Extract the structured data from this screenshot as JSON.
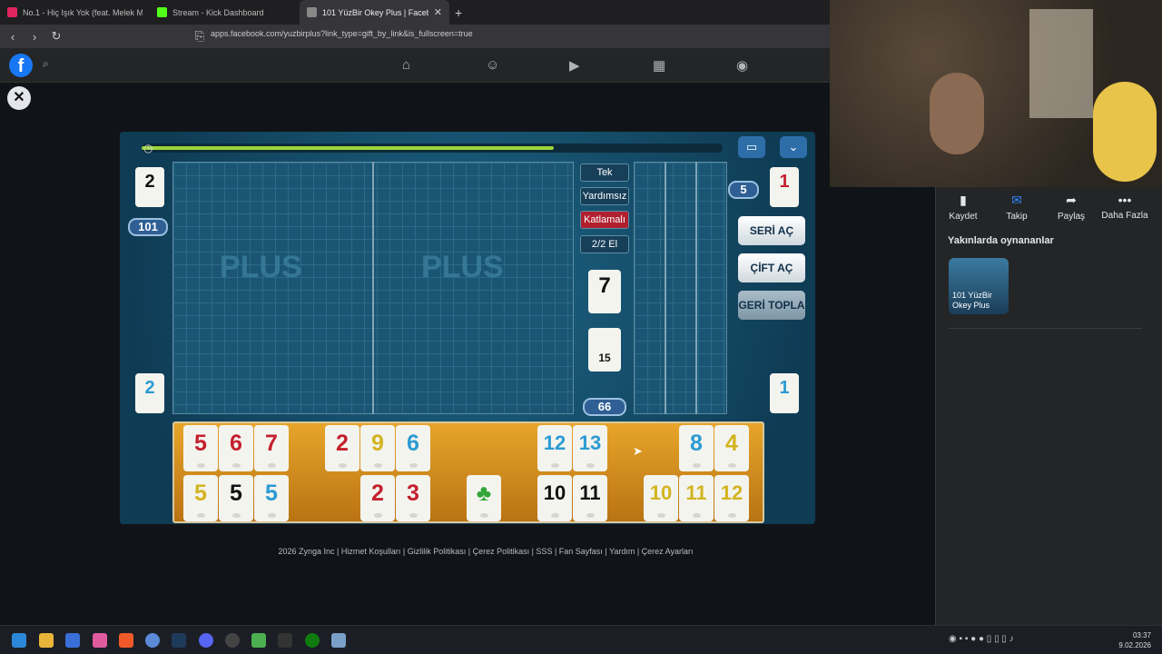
{
  "tabs": [
    {
      "title": "No.1 - Hiç Işık Yok (feat. Melek M",
      "color": "#e0245e"
    },
    {
      "title": "Stream - Kick Dashboard",
      "color": "#53fc18"
    },
    {
      "title": "101 YüzBir Okey Plus | Faceb",
      "color": "#888888"
    }
  ],
  "address": {
    "url": "apps.facebook.com/yuzbirplus?link_type=gift_by_link&is_fullscreen=true"
  },
  "facebook": {
    "logo": "f",
    "close_label": "✕"
  },
  "game": {
    "labels": {
      "mode": "Tek",
      "help": "Yardımsız",
      "fold": "Katlamalı",
      "hand": "2/2 El"
    },
    "center_tile": "7",
    "deck_count": "15",
    "remaining": "66",
    "opponent_tiles": {
      "top_left": "2",
      "bottom_left": "2",
      "top_right": "1",
      "bottom_right": "1"
    },
    "score_badge": "101",
    "right_badge": "5",
    "buttons": {
      "series": "SERİ AÇ",
      "pairs": "ÇİFT AÇ",
      "undo": "GERİ TOPLA"
    },
    "timer_progress": 0.71,
    "rack_top": [
      {
        "v": "5",
        "c": "red"
      },
      {
        "v": "6",
        "c": "red"
      },
      {
        "v": "7",
        "c": "red"
      },
      {
        "v": "2",
        "c": "red"
      },
      {
        "v": "9",
        "c": "yellow"
      },
      {
        "v": "6",
        "c": "blue"
      },
      {
        "v": "12",
        "c": "blue"
      },
      {
        "v": "13",
        "c": "blue"
      },
      {
        "v": "8",
        "c": "blue"
      },
      {
        "v": "4",
        "c": "yellow"
      }
    ],
    "rack_bottom": [
      {
        "v": "5",
        "c": "yellow"
      },
      {
        "v": "5",
        "c": "black"
      },
      {
        "v": "5",
        "c": "blue"
      },
      {
        "v": "2",
        "c": "red"
      },
      {
        "v": "3",
        "c": "red"
      },
      {
        "v": "♣",
        "c": "green"
      },
      {
        "v": "10",
        "c": "black"
      },
      {
        "v": "11",
        "c": "black"
      },
      {
        "v": "10",
        "c": "yellow"
      },
      {
        "v": "11",
        "c": "yellow"
      },
      {
        "v": "12",
        "c": "yellow"
      }
    ]
  },
  "footer": "2026 Zynga Inc | Hizmet Koşulları | Gizlilik Politikası | Çerez Politikası | SSS | Fan Sayfası | Yardım | Çerez Ayarları",
  "sidebar": {
    "actions": [
      "Kaydet",
      "Takip",
      "Paylaş",
      "Daha Fazla"
    ],
    "recent_title": "Yakınlarda oynananlar",
    "recent_game": "101 YüzBir Okey Plus"
  },
  "taskbar": {
    "time": "03:37",
    "date": "9.02.2026"
  }
}
